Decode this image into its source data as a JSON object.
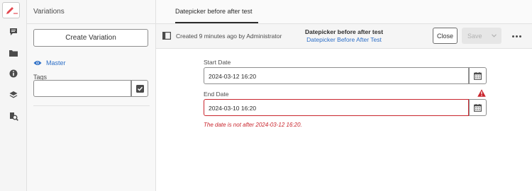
{
  "rail": {
    "items": [
      {
        "icon": "pencil-icon",
        "active": true
      },
      {
        "icon": "comment-icon"
      },
      {
        "icon": "folder-icon"
      },
      {
        "icon": "info-icon"
      },
      {
        "icon": "layers-icon"
      },
      {
        "icon": "search-usage-icon"
      }
    ]
  },
  "panel": {
    "title": "Variations",
    "create_label": "Create Variation",
    "master_label": "Master",
    "tags_label": "Tags",
    "tags_value": ""
  },
  "tab": {
    "label": "Datepicker before after test"
  },
  "toolbar": {
    "info": "Created 9 minutes ago by Administrator",
    "title": "Datepicker before after test",
    "subtitle": "Datepicker Before After Test",
    "close_label": "Close",
    "save_label": "Save"
  },
  "form": {
    "start_label": "Start Date",
    "start_value": "2024-03-12 16:20",
    "end_label": "End Date",
    "end_value": "2024-03-10 16:20",
    "error": "The date is not after 2024-03-12 16:20."
  },
  "colors": {
    "accent": "#2d6fc7",
    "error": "#c9252d",
    "active_icon": "#e34850"
  }
}
